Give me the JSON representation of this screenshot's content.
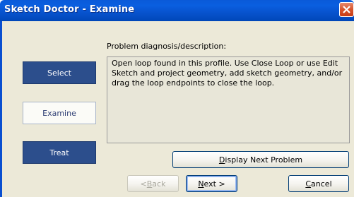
{
  "window": {
    "title": "Sketch Doctor - Examine"
  },
  "nav": {
    "select_label": "Select",
    "examine_label": "Examine",
    "treat_label": "Treat"
  },
  "diagnosis": {
    "label": "Problem diagnosis/description:",
    "text": "Open loop found in this profile.  Use Close Loop or use Edit Sketch and project geometry, add sketch geometry, and/or drag the loop endpoints to close the loop."
  },
  "buttons": {
    "display_next_problem": {
      "mnemonic": "D",
      "rest": "isplay Next Problem"
    },
    "back": {
      "pre": "< ",
      "mnemonic": "B",
      "rest": "ack"
    },
    "next": {
      "mnemonic": "N",
      "rest": "ext >"
    },
    "cancel": {
      "mnemonic": "C",
      "rest": "ancel"
    }
  },
  "icons": {
    "close": "close-icon"
  },
  "colors": {
    "titlebar": "#0a5ad8",
    "nav_dark": "#2c4e8c",
    "dialog_bg": "#ece9d8",
    "close_button": "#d8542c"
  }
}
